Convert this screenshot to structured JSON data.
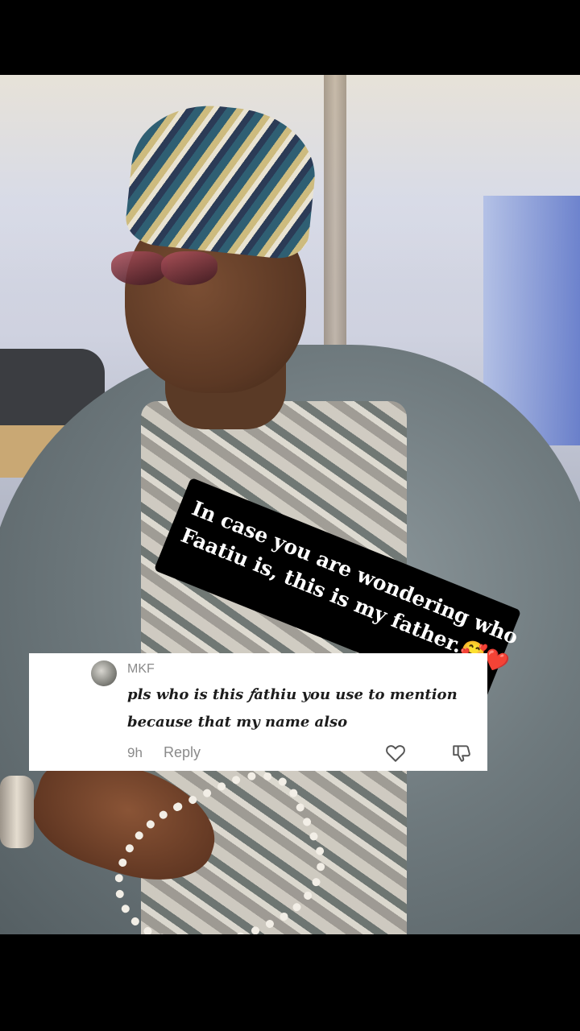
{
  "overlay_caption": {
    "lines": [
      "In case you are wondering who",
      "Faatiu is, this is my father.🥰❤️"
    ]
  },
  "comment": {
    "username": "MKF",
    "text_line1": "pls who is this 𝑓athiu you use to mention",
    "text_line2": "because that my name also",
    "time": "9h",
    "reply_label": "Reply"
  },
  "icons": {
    "like": "heart-outline-icon",
    "dislike": "thumbs-down-icon"
  }
}
